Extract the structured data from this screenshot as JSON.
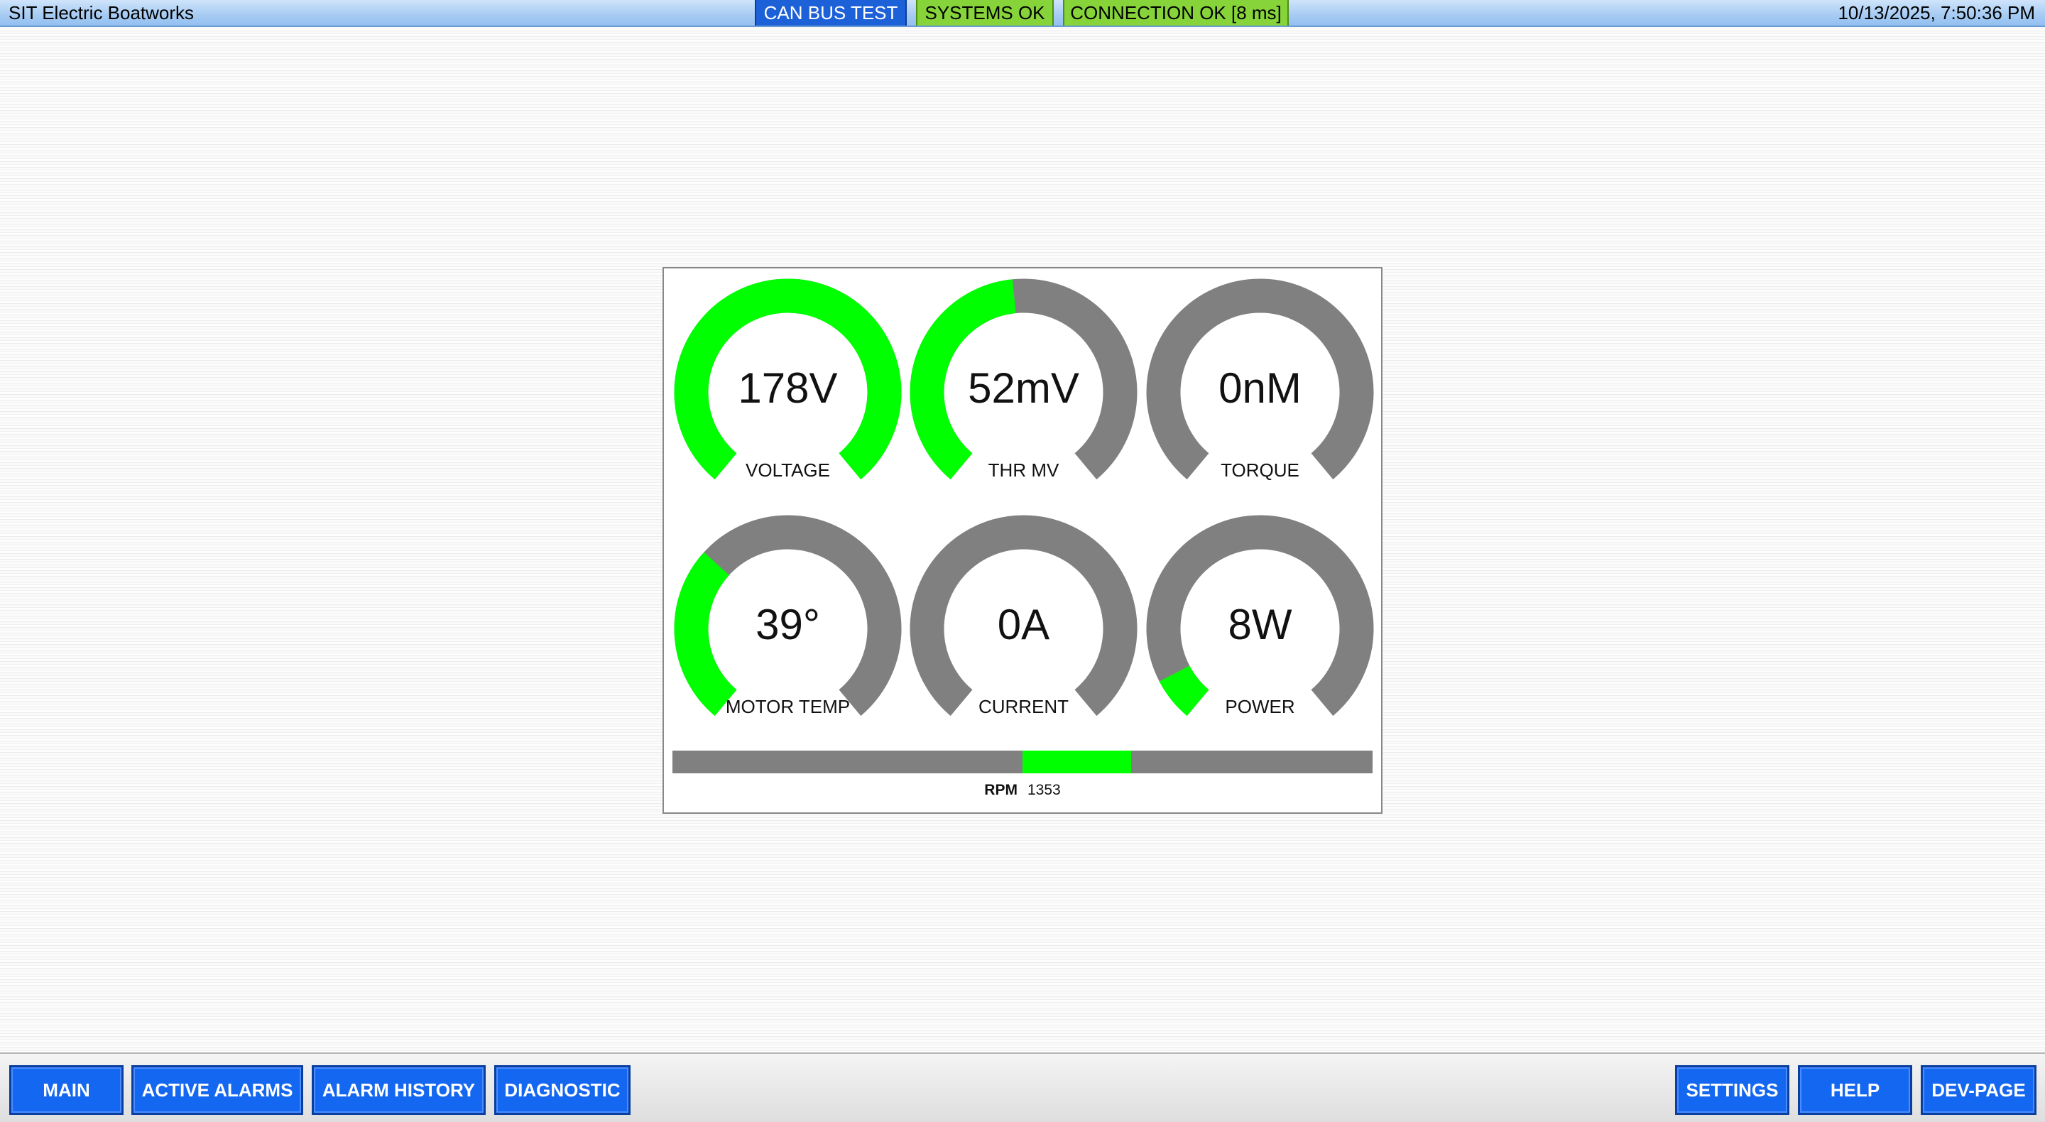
{
  "header": {
    "app_title": "SIT Electric Boatworks",
    "status": {
      "canbus": "CAN BUS TEST",
      "systems": "SYSTEMS OK",
      "connection": "CONNECTION OK [8 ms]"
    },
    "datetime": "10/13/2025, 7:50:36 PM"
  },
  "colors": {
    "active": "#00ff00",
    "inactive": "#808080",
    "nav_button": "#1467f0",
    "topbar": "#a9cdf3",
    "status_ok": "#86d43a",
    "status_test": "#1d61d8"
  },
  "gauges": [
    {
      "value": "178V",
      "label": "VOLTAGE",
      "fill_fraction": 1.0,
      "fill_from": "start"
    },
    {
      "value": "52mV",
      "label": "THR MV",
      "fill_fraction": 0.48,
      "fill_from": "start"
    },
    {
      "value": "0nM",
      "label": "TORQUE",
      "fill_fraction": 0.0,
      "fill_from": "start"
    },
    {
      "value": "39°",
      "label": "MOTOR TEMP",
      "fill_fraction": 0.33,
      "fill_from": "start"
    },
    {
      "value": "0A",
      "label": "CURRENT",
      "fill_fraction": 0.0,
      "fill_from": "start"
    },
    {
      "value": "8W",
      "label": "POWER",
      "fill_fraction": 0.08,
      "fill_from": "start"
    }
  ],
  "rpm": {
    "label": "RPM",
    "value": "1353",
    "fill_start_fraction": 0.5,
    "fill_end_fraction": 0.655
  },
  "nav": {
    "main": "MAIN",
    "active_alarms": "ACTIVE ALARMS",
    "alarm_history": "ALARM HISTORY",
    "diagnostic": "DIAGNOSTIC",
    "settings": "SETTINGS",
    "help": "HELP",
    "dev_page": "DEV-PAGE"
  }
}
